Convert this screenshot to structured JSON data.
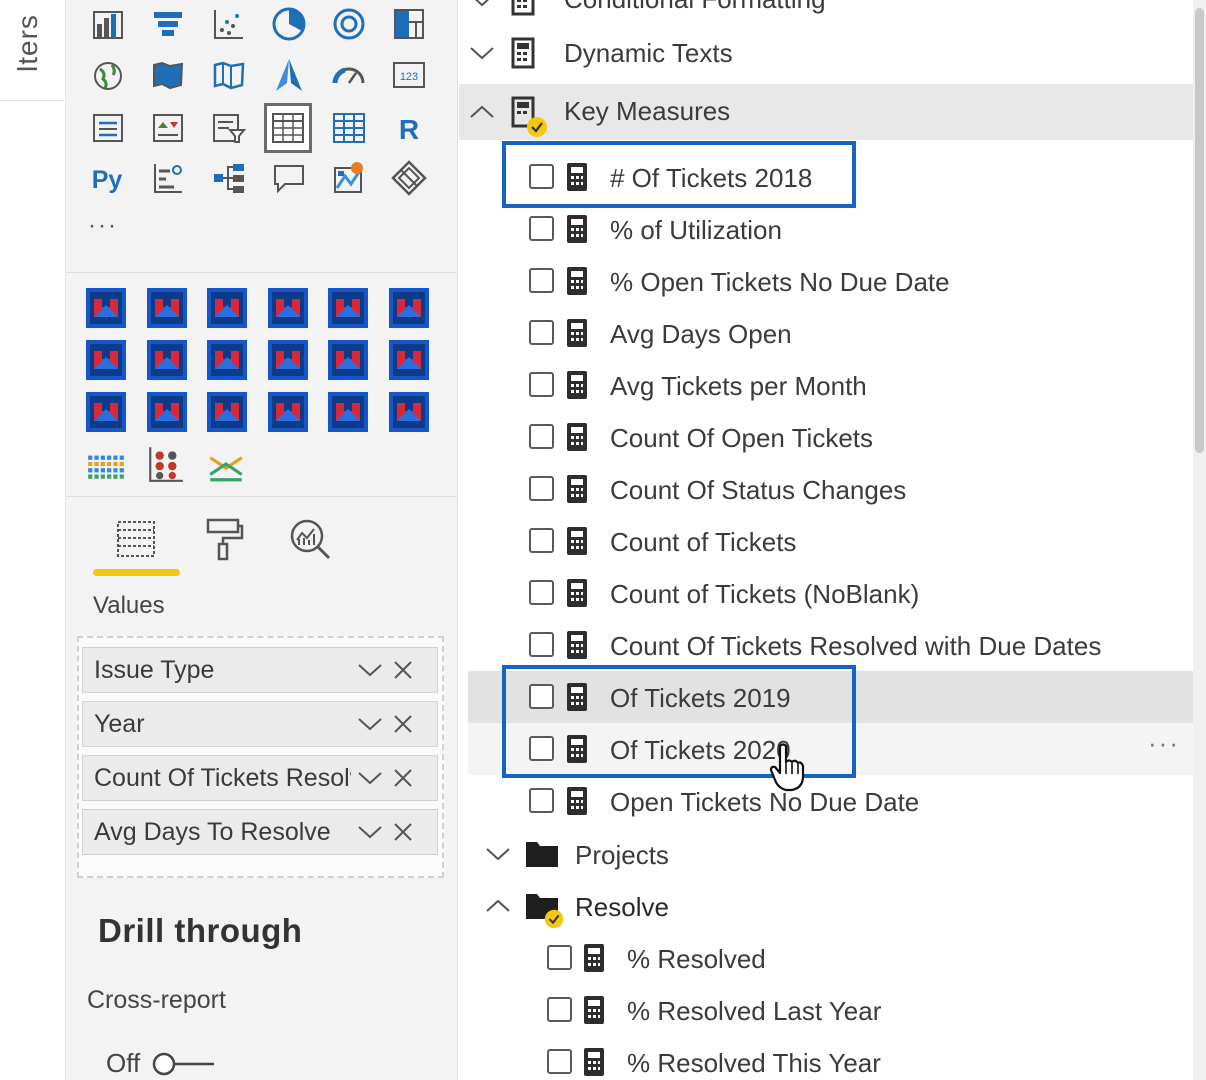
{
  "filters": {
    "label": "lters"
  },
  "visualizations": {
    "more_label": "···",
    "builtin_icons": [
      "stacked-column-chart-icon",
      "funnel-chart-icon",
      "scatter-chart-icon",
      "pie-chart-icon",
      "donut-chart-icon",
      "treemap-icon",
      "map-icon",
      "filled-map-icon",
      "shape-map-icon",
      "azure-map-icon",
      "gauge-icon",
      "card-icon",
      "multi-row-card-icon",
      "kpi-icon",
      "slicer-icon",
      "table-icon",
      "matrix-icon",
      "r-visual-icon",
      "python-visual-icon",
      "key-influencers-icon",
      "decomposition-tree-icon",
      "qa-icon",
      "arcgis-map-icon",
      "power-apps-icon"
    ],
    "python_label": "Py",
    "r_label": "R",
    "card_label": "123",
    "custom_visual_count": 18,
    "extra_custom_icons": [
      "heatmap-grid-icon",
      "dot-plot-icon",
      "range-chart-icon"
    ],
    "tabs": [
      {
        "name": "fields-tab-icon",
        "active": true
      },
      {
        "name": "format-tab-icon",
        "active": false
      },
      {
        "name": "analytics-tab-icon",
        "active": false
      }
    ],
    "values_label": "Values",
    "value_fields": [
      "Issue Type",
      "Year",
      "Count Of Tickets Resolv",
      "Avg Days To Resolve"
    ],
    "drill_through_title": "Drill through",
    "cross_report_label": "Cross-report",
    "cross_report_value": "Off",
    "accent_color": "#f2c811"
  },
  "fields": {
    "conditional_formatting": "Conditional Formatting",
    "dynamic_texts": "Dynamic Texts",
    "key_measures": "Key Measures",
    "measures": [
      "# Of Tickets 2018",
      "% of Utilization",
      "% Open Tickets No Due Date",
      "Avg Days Open",
      "Avg Tickets per Month",
      "Count Of Open Tickets",
      "Count Of Status Changes",
      "Count of Tickets",
      "Count of Tickets (NoBlank)",
      "Count Of Tickets Resolved with Due Dates",
      "Of Tickets 2019",
      "Of Tickets 2020",
      "Open Tickets No Due Date"
    ],
    "projects": "Projects",
    "resolve": "Resolve",
    "resolve_measures": [
      "% Resolved",
      "% Resolved Last Year",
      "% Resolved This Year"
    ],
    "more_options": "···",
    "highlight_color": "#1565c0",
    "badge_color": "#f2c811"
  }
}
